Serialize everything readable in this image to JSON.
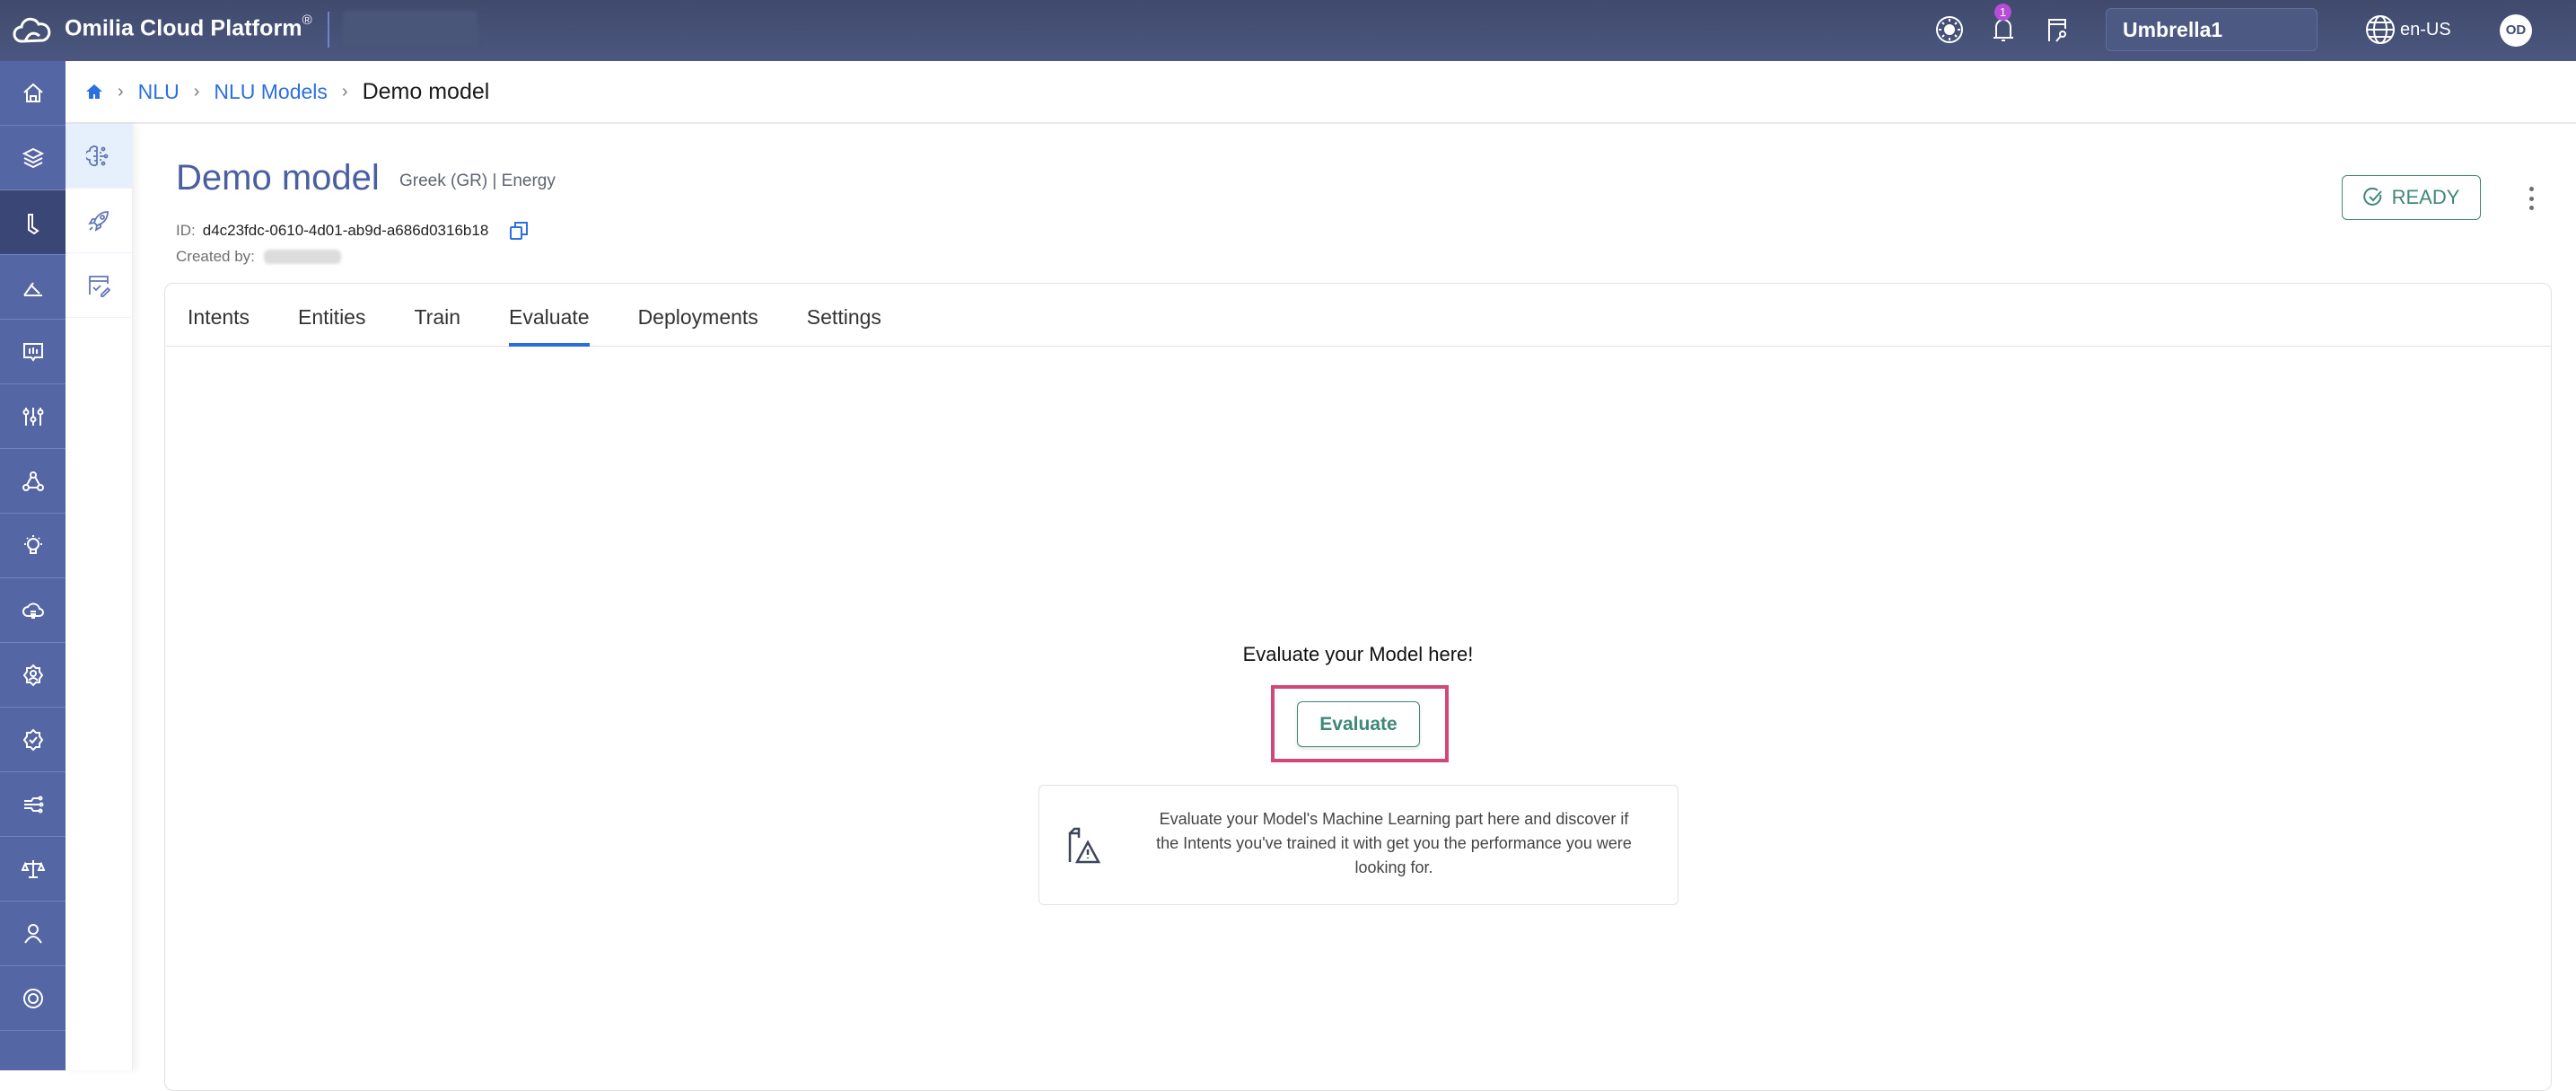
{
  "topbar": {
    "brand": "Omilia Cloud Platform",
    "brand_mark": "®",
    "notification_count": "1",
    "tenant": "Umbrella1",
    "language": "en-US",
    "user_initials": "OD",
    "icons": [
      "theme-icon",
      "bell-icon",
      "api-keys-icon",
      "globe-icon"
    ]
  },
  "sidebar": {
    "items": [
      {
        "name": "home",
        "icon": "home-icon",
        "active": false
      },
      {
        "name": "layers",
        "icon": "layers-icon",
        "active": false
      },
      {
        "name": "nlu",
        "icon": "nlu-icon",
        "active": true
      },
      {
        "name": "analytics",
        "icon": "angle-icon",
        "active": false
      },
      {
        "name": "insights",
        "icon": "chat-chart-icon",
        "active": false
      },
      {
        "name": "tuning",
        "icon": "sliders-icon",
        "active": false
      },
      {
        "name": "orchestrator",
        "icon": "nodes-icon",
        "active": false
      },
      {
        "name": "ideas",
        "icon": "lightbulb-icon",
        "active": false
      },
      {
        "name": "cloud",
        "icon": "cloud-icon",
        "active": false
      },
      {
        "name": "user-settings",
        "icon": "user-gear-icon",
        "active": false
      },
      {
        "name": "verification",
        "icon": "badge-check-icon",
        "active": false
      },
      {
        "name": "integrations",
        "icon": "circuit-icon",
        "active": false
      },
      {
        "name": "compliance",
        "icon": "scales-icon",
        "active": false
      },
      {
        "name": "account",
        "icon": "user-icon",
        "active": false
      },
      {
        "name": "support",
        "icon": "lifebuoy-icon",
        "active": false
      }
    ]
  },
  "subnav": {
    "items": [
      {
        "name": "nlu-models",
        "icon": "brain-icon",
        "active": true
      },
      {
        "name": "deployments",
        "icon": "rocket-icon",
        "active": false
      },
      {
        "name": "annotations",
        "icon": "edit-check-icon",
        "active": false
      }
    ]
  },
  "breadcrumb": {
    "items": [
      "NLU",
      "NLU Models"
    ],
    "current": "Demo model"
  },
  "model": {
    "title": "Demo model",
    "meta": "Greek (GR) | Energy",
    "id_label": "ID:",
    "id": "d4c23fdc-0610-4d01-ab9d-a686d0316b18",
    "created_label": "Created by:",
    "status": "READY"
  },
  "tabs": [
    {
      "label": "Intents",
      "active": false
    },
    {
      "label": "Entities",
      "active": false
    },
    {
      "label": "Train",
      "active": false
    },
    {
      "label": "Evaluate",
      "active": true
    },
    {
      "label": "Deployments",
      "active": false
    },
    {
      "label": "Settings",
      "active": false
    }
  ],
  "evaluate": {
    "heading": "Evaluate your Model here!",
    "button_label": "Evaluate",
    "info_text": "Evaluate your Model's Machine Learning part here and discover if the Intents you've trained it with get you the performance you were looking for."
  },
  "colors": {
    "topbar": "#434d70",
    "sidebar": "#5467a4",
    "sidebar_active": "#3a4776",
    "accent_link": "#2c6fe0",
    "status_green": "#3f8778",
    "highlight": "#d1477a",
    "title": "#4a5fa0"
  }
}
